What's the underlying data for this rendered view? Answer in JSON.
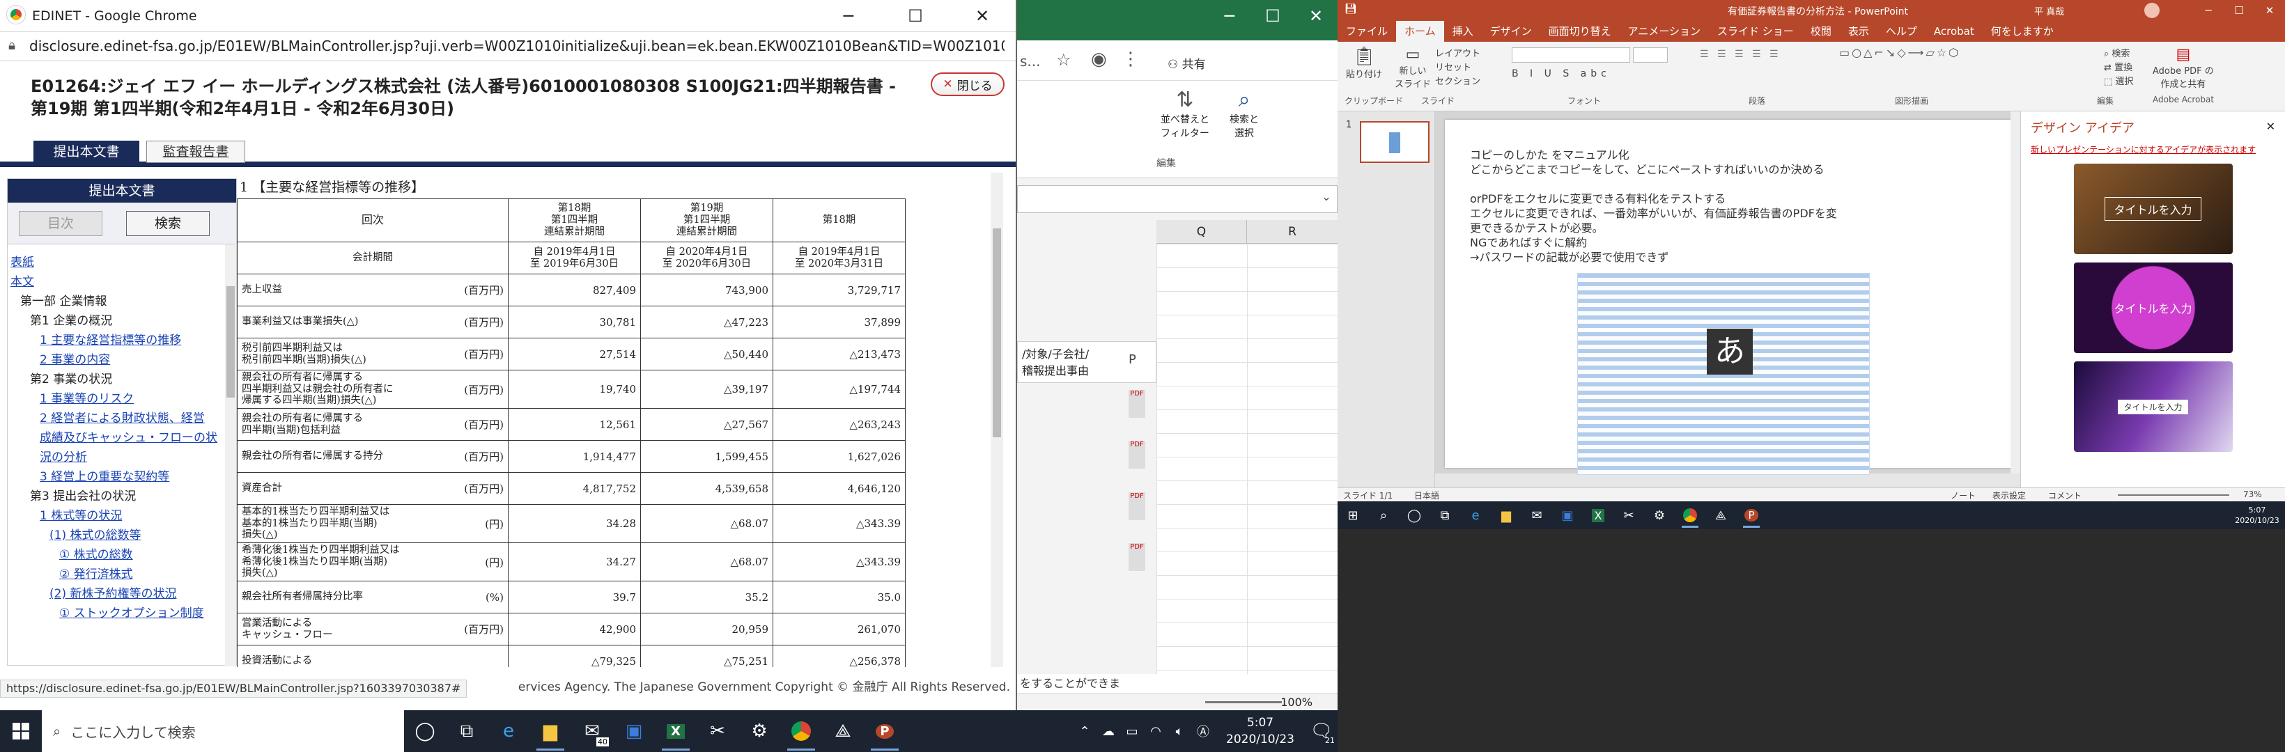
{
  "chrome": {
    "title": "EDINET - Google Chrome",
    "url": "disclosure.edinet-fsa.go.jp/E01EW/BLMainController.jsp?uji.verb=W00Z1010initialize&uji.bean=ek.bean.EKW00Z1010Bean&TID=W00Z1010&PID=...",
    "status_url": "https://disclosure.edinet-fsa.go.jp/E01EW/BLMainController.jsp?1603397030387#",
    "footer": "ervices Agency. The Japanese Government Copyright © 金融庁 All Rights Reserved."
  },
  "doc": {
    "header_line1": "E01264:ジェイ エフ イー ホールディングス株式会社 (法人番号)6010001080308 S100JG21:四半期報告書 -",
    "header_line2": "第19期 第1四半期(令和2年4月1日 - 令和2年6月30日)",
    "close_label": "閉じる",
    "tab_submitted": "提出本文書",
    "tab_audit": "監査報告書",
    "sidebar_title": "提出本文書",
    "toc_button": "目次",
    "search_button": "検索",
    "section_title": "1 【主要な経営指標等の推移】",
    "toc": [
      {
        "text": "表紙",
        "link": true,
        "indent": 0
      },
      {
        "text": "本文",
        "link": true,
        "indent": 0
      },
      {
        "text": "第一部 企業情報",
        "link": false,
        "indent": 1
      },
      {
        "text": "第1 企業の概況",
        "link": false,
        "indent": 2
      },
      {
        "text": "1 主要な経営指標等の推移",
        "link": true,
        "indent": 3
      },
      {
        "text": "2 事業の内容",
        "link": true,
        "indent": 3
      },
      {
        "text": "第2 事業の状況",
        "link": false,
        "indent": 2
      },
      {
        "text": "1 事業等のリスク",
        "link": true,
        "indent": 3
      },
      {
        "text": "2 経営者による財政状態、経営",
        "link": true,
        "indent": 3
      },
      {
        "text": "成績及びキャッシュ・フローの状",
        "link": true,
        "indent": 3
      },
      {
        "text": "況の分析",
        "link": true,
        "indent": 3
      },
      {
        "text": "3 経営上の重要な契約等",
        "link": true,
        "indent": 3
      },
      {
        "text": "第3 提出会社の状況",
        "link": false,
        "indent": 2
      },
      {
        "text": "1 株式等の状況",
        "link": true,
        "indent": 3
      },
      {
        "text": "(1) 株式の総数等",
        "link": true,
        "indent": 4
      },
      {
        "text": "① 株式の総数",
        "link": true,
        "indent": 5
      },
      {
        "text": "② 発行済株式",
        "link": true,
        "indent": 5
      },
      {
        "text": "(2) 新株予約権等の状況",
        "link": true,
        "indent": 4
      },
      {
        "text": "① ストックオプション制度",
        "link": true,
        "indent": 5
      }
    ],
    "table_head": {
      "c0": "回次",
      "c1": "第18期\n第1四半期\n連結累計期間",
      "c2": "第19期\n第1四半期\n連結累計期間",
      "c3": "第18期",
      "p0": "会計期間",
      "p1": "自 2019年4月1日\n至 2019年6月30日",
      "p2": "自 2020年4月1日\n至 2020年6月30日",
      "p3": "自 2019年4月1日\n至 2020年3月31日"
    },
    "rows": [
      {
        "label": "売上収益",
        "unit": "(百万円)",
        "v1": "827,409",
        "v2": "743,900",
        "v3": "3,729,717"
      },
      {
        "label": "事業利益又は事業損失(△)",
        "unit": "(百万円)",
        "v1": "30,781",
        "v2": "△47,223",
        "v3": "37,899"
      },
      {
        "label": "税引前四半期利益又は\n税引前四半期(当期)損失(△)",
        "unit": "(百万円)",
        "v1": "27,514",
        "v2": "△50,440",
        "v3": "△213,473"
      },
      {
        "label": "親会社の所有者に帰属する\n四半期利益又は親会社の所有者に\n帰属する四半期(当期)損失(△)",
        "unit": "(百万円)",
        "v1": "19,740",
        "v2": "△39,197",
        "v3": "△197,744"
      },
      {
        "label": "親会社の所有者に帰属する\n四半期(当期)包括利益",
        "unit": "(百万円)",
        "v1": "12,561",
        "v2": "△27,567",
        "v3": "△263,243"
      },
      {
        "label": "親会社の所有者に帰属する持分",
        "unit": "(百万円)",
        "v1": "1,914,477",
        "v2": "1,599,455",
        "v3": "1,627,026"
      },
      {
        "label": "資産合計",
        "unit": "(百万円)",
        "v1": "4,817,752",
        "v2": "4,539,658",
        "v3": "4,646,120"
      },
      {
        "label": "基本的1株当たり四半期利益又は\n基本的1株当たり四半期(当期)\n損失(△)",
        "unit": "(円)",
        "v1": "34.28",
        "v2": "△68.07",
        "v3": "△343.39"
      },
      {
        "label": "希薄化後1株当たり四半期利益又は\n希薄化後1株当たり四半期(当期)\n損失(△)",
        "unit": "(円)",
        "v1": "34.27",
        "v2": "△68.07",
        "v3": "△343.39"
      },
      {
        "label": "親会社所有者帰属持分比率",
        "unit": "(%)",
        "v1": "39.7",
        "v2": "35.2",
        "v3": "35.0"
      },
      {
        "label": "営業活動による\nキャッシュ・フロー",
        "unit": "(百万円)",
        "v1": "42,900",
        "v2": "20,959",
        "v3": "261,070"
      },
      {
        "label": "投資活動による",
        "unit": "",
        "v1": "△79,325",
        "v2": "△75,251",
        "v3": "△256,378"
      }
    ]
  },
  "middle": {
    "share": "共有",
    "sort_label": "並べ替えと\nフィルター",
    "find_label": "検索と\n選択",
    "edit_group": "編集",
    "cols": [
      "Q",
      "R"
    ],
    "peek_header": "/対象/子会社/\n稽報提出事由",
    "peek_col": "P",
    "zoom": "100%",
    "footer_text": "をすることができま"
  },
  "ppt": {
    "title": "有価証券報告書の分析方法 - PowerPoint",
    "user": "平 真哉",
    "tabs": [
      "ファイル",
      "ホーム",
      "挿入",
      "デザイン",
      "画面切り替え",
      "アニメーション",
      "スライド ショー",
      "校閲",
      "表示",
      "ヘルプ",
      "Acrobat",
      "何をしますか"
    ],
    "groups": [
      "クリップボード",
      "スライド",
      "フォント",
      "段落",
      "図形描画",
      "編集",
      "Adobe Acrobat"
    ],
    "ribbon_paste": "貼り付け",
    "ribbon_new": "新しい\nスライド",
    "ribbon_layout": "レイアウト",
    "ribbon_reset": "リセット",
    "ribbon_section": "セクション",
    "ribbon_find": "検索",
    "ribbon_replace": "置換",
    "ribbon_select": "選択",
    "ribbon_pdf": "Adobe PDF の\n作成と共有",
    "slide_num": "1",
    "slide_text": [
      "コピーのしかた をマニュアル化",
      "どこからどこまでコピーをして、どこにペーストすればいいのか決める",
      "",
      "orPDFをエクセルに変更できる有料化をテストする",
      "エクセルに変更できれば、一番効率がいいが、有価証券報告書のPDFを変",
      "更できるかテストが必要。",
      "NGであればすぐに解約",
      "→パスワードの記載が必要で使用できず"
    ],
    "ime": "あ",
    "design_title": "デザイン アイデア",
    "design_note": "新しいプレゼンテーションに対するアイデアが表示されます",
    "design_cards": [
      "タイトルを入力",
      "タイトルを入力",
      "タイトルを入力"
    ],
    "status_slide": "スライド 1/1",
    "status_lang": "日本語",
    "status_notes": "ノート",
    "status_display": "表示設定",
    "status_comment": "コメント",
    "zoom": "73%"
  },
  "taskbar_main": {
    "search_placeholder": "ここに入力して検索",
    "time": "5:07",
    "date": "2020/10/23",
    "notif": "21",
    "mail_badge": "40"
  },
  "taskbar_right": {
    "time": "5:07",
    "date": "2020/10/23"
  },
  "colors": {
    "ppt_red": "#b7472a",
    "excel_green": "#217346",
    "edinet_navy": "#1a2b5a",
    "link_blue": "#1a44b5"
  }
}
